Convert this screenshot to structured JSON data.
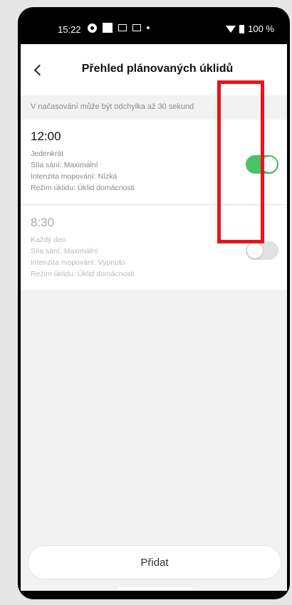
{
  "status_bar": {
    "time": "15:22",
    "battery": "100 %",
    "icons": [
      "github-icon",
      "square-icon",
      "card-icon",
      "card-icon",
      "dot-icon",
      "wifi-icon",
      "battery-icon"
    ]
  },
  "header": {
    "title": "Přehled plánovaných úklidů",
    "back_icon": "chevron-left-icon"
  },
  "hint": "V načasování může být odchylka až 30 sekund",
  "schedules": [
    {
      "time": "12:00",
      "repeat": "Jedenkrát",
      "suction": "Síla sání: Maximální",
      "mopping": "Intenzita mopování: Nízká",
      "mode": "Režim úklidu: Úklid domácnosti",
      "enabled": true
    },
    {
      "time": "8:30",
      "repeat": "Každý den",
      "suction": "Síla sání: Maximální",
      "mopping": "Intenzita mopování: Vypnuto",
      "mode": "Režim úklidu: Úklid domácnosti",
      "enabled": false
    }
  ],
  "add_button_label": "Přidat",
  "colors": {
    "toggle_on": "#4cc266",
    "toggle_off": "#e1e1e1",
    "highlight": "#e8141a"
  }
}
